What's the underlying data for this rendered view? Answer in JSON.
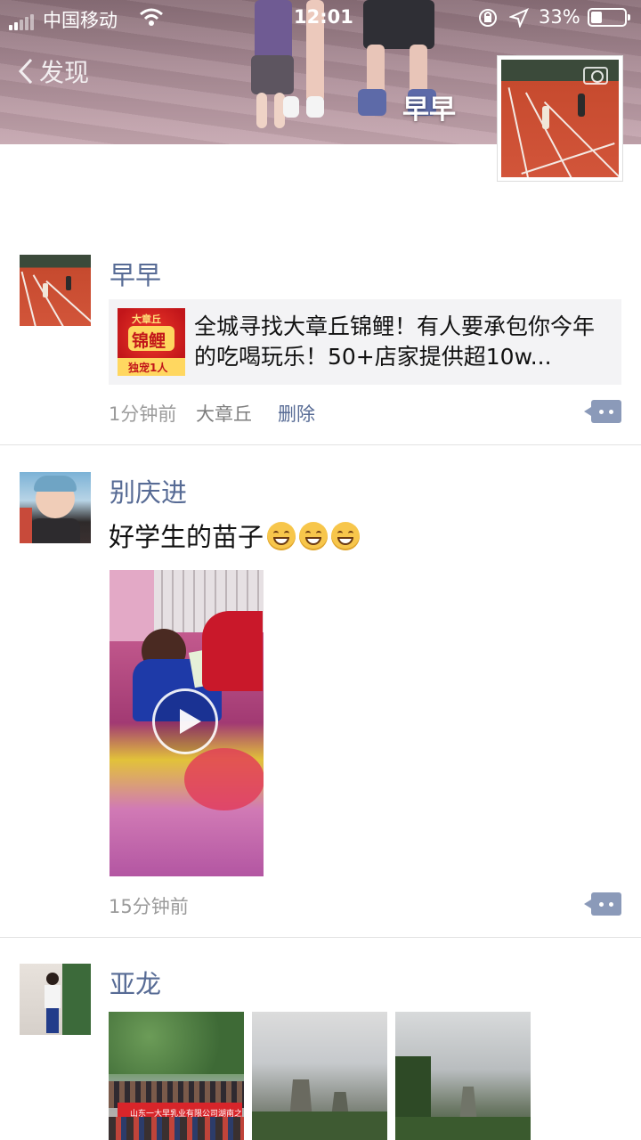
{
  "status_bar": {
    "carrier": "中国移动",
    "time": "12:01",
    "battery": "33%"
  },
  "header": {
    "back_label": "发现",
    "cover_username": "早早"
  },
  "posts": [
    {
      "author": "早早",
      "share": {
        "badge_top": "大章丘",
        "badge_main": "锦鲤",
        "badge_bottom": "独宠1人",
        "title": "全城寻找大章丘锦鲤！有人要承包你今年的吃喝玩乐！50+店家提供超10w..."
      },
      "time": "1分钟前",
      "location": "大章丘",
      "delete_label": "删除"
    },
    {
      "author": "别庆进",
      "text": "好学生的苗子",
      "emoji": [
        "grin-icon",
        "grin-icon",
        "grin-icon"
      ],
      "time": "15分钟前"
    },
    {
      "author": "亚龙",
      "photo_banner": "山东一大早乳业有限公司湖南之旅"
    }
  ],
  "colors": {
    "link": "#576b95",
    "meta": "#9b9b9b",
    "divider": "#e2e2e2",
    "comment_button": "#8b9ab9"
  }
}
